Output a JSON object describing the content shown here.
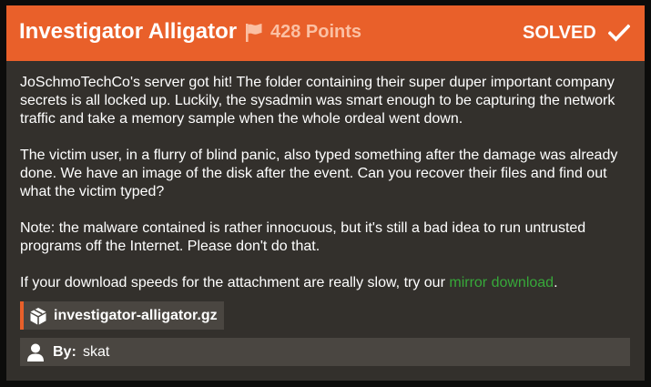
{
  "challenge": {
    "title": "Investigator Alligator",
    "points": "428 Points",
    "status": "SOLVED",
    "flag_icon": "flag-icon",
    "status_icon": "checkmark-icon"
  },
  "description": {
    "p1": "JoSchmoTechCo's server got hit! The folder containing their super duper important company secrets is all locked up. Luckily, the sysadmin was smart enough to be capturing the network traffic and take a memory sample when the whole ordeal went down.",
    "p2": "The victim user, in a flurry of blind panic, also typed something after the damage was already done. We have an image of the disk after the event. Can you recover their files and find out what the victim typed?",
    "p3": "Note: the malware contained is rather innocuous, but it's still a bad idea to run untrusted programs off the Internet. Please don't do that.",
    "p4_before": "If your download speeds for the attachment are really slow, try our ",
    "p4_link": "mirror download",
    "p4_after": "."
  },
  "attachment": {
    "filename": "investigator-alligator.gz",
    "icon": "package-icon"
  },
  "author": {
    "label": "By:",
    "name": "skat",
    "icon": "user-icon"
  },
  "colors": {
    "accent": "#e9602a",
    "card_bg": "#33302c",
    "link": "#37a93a",
    "points": "#fbc0a3"
  }
}
